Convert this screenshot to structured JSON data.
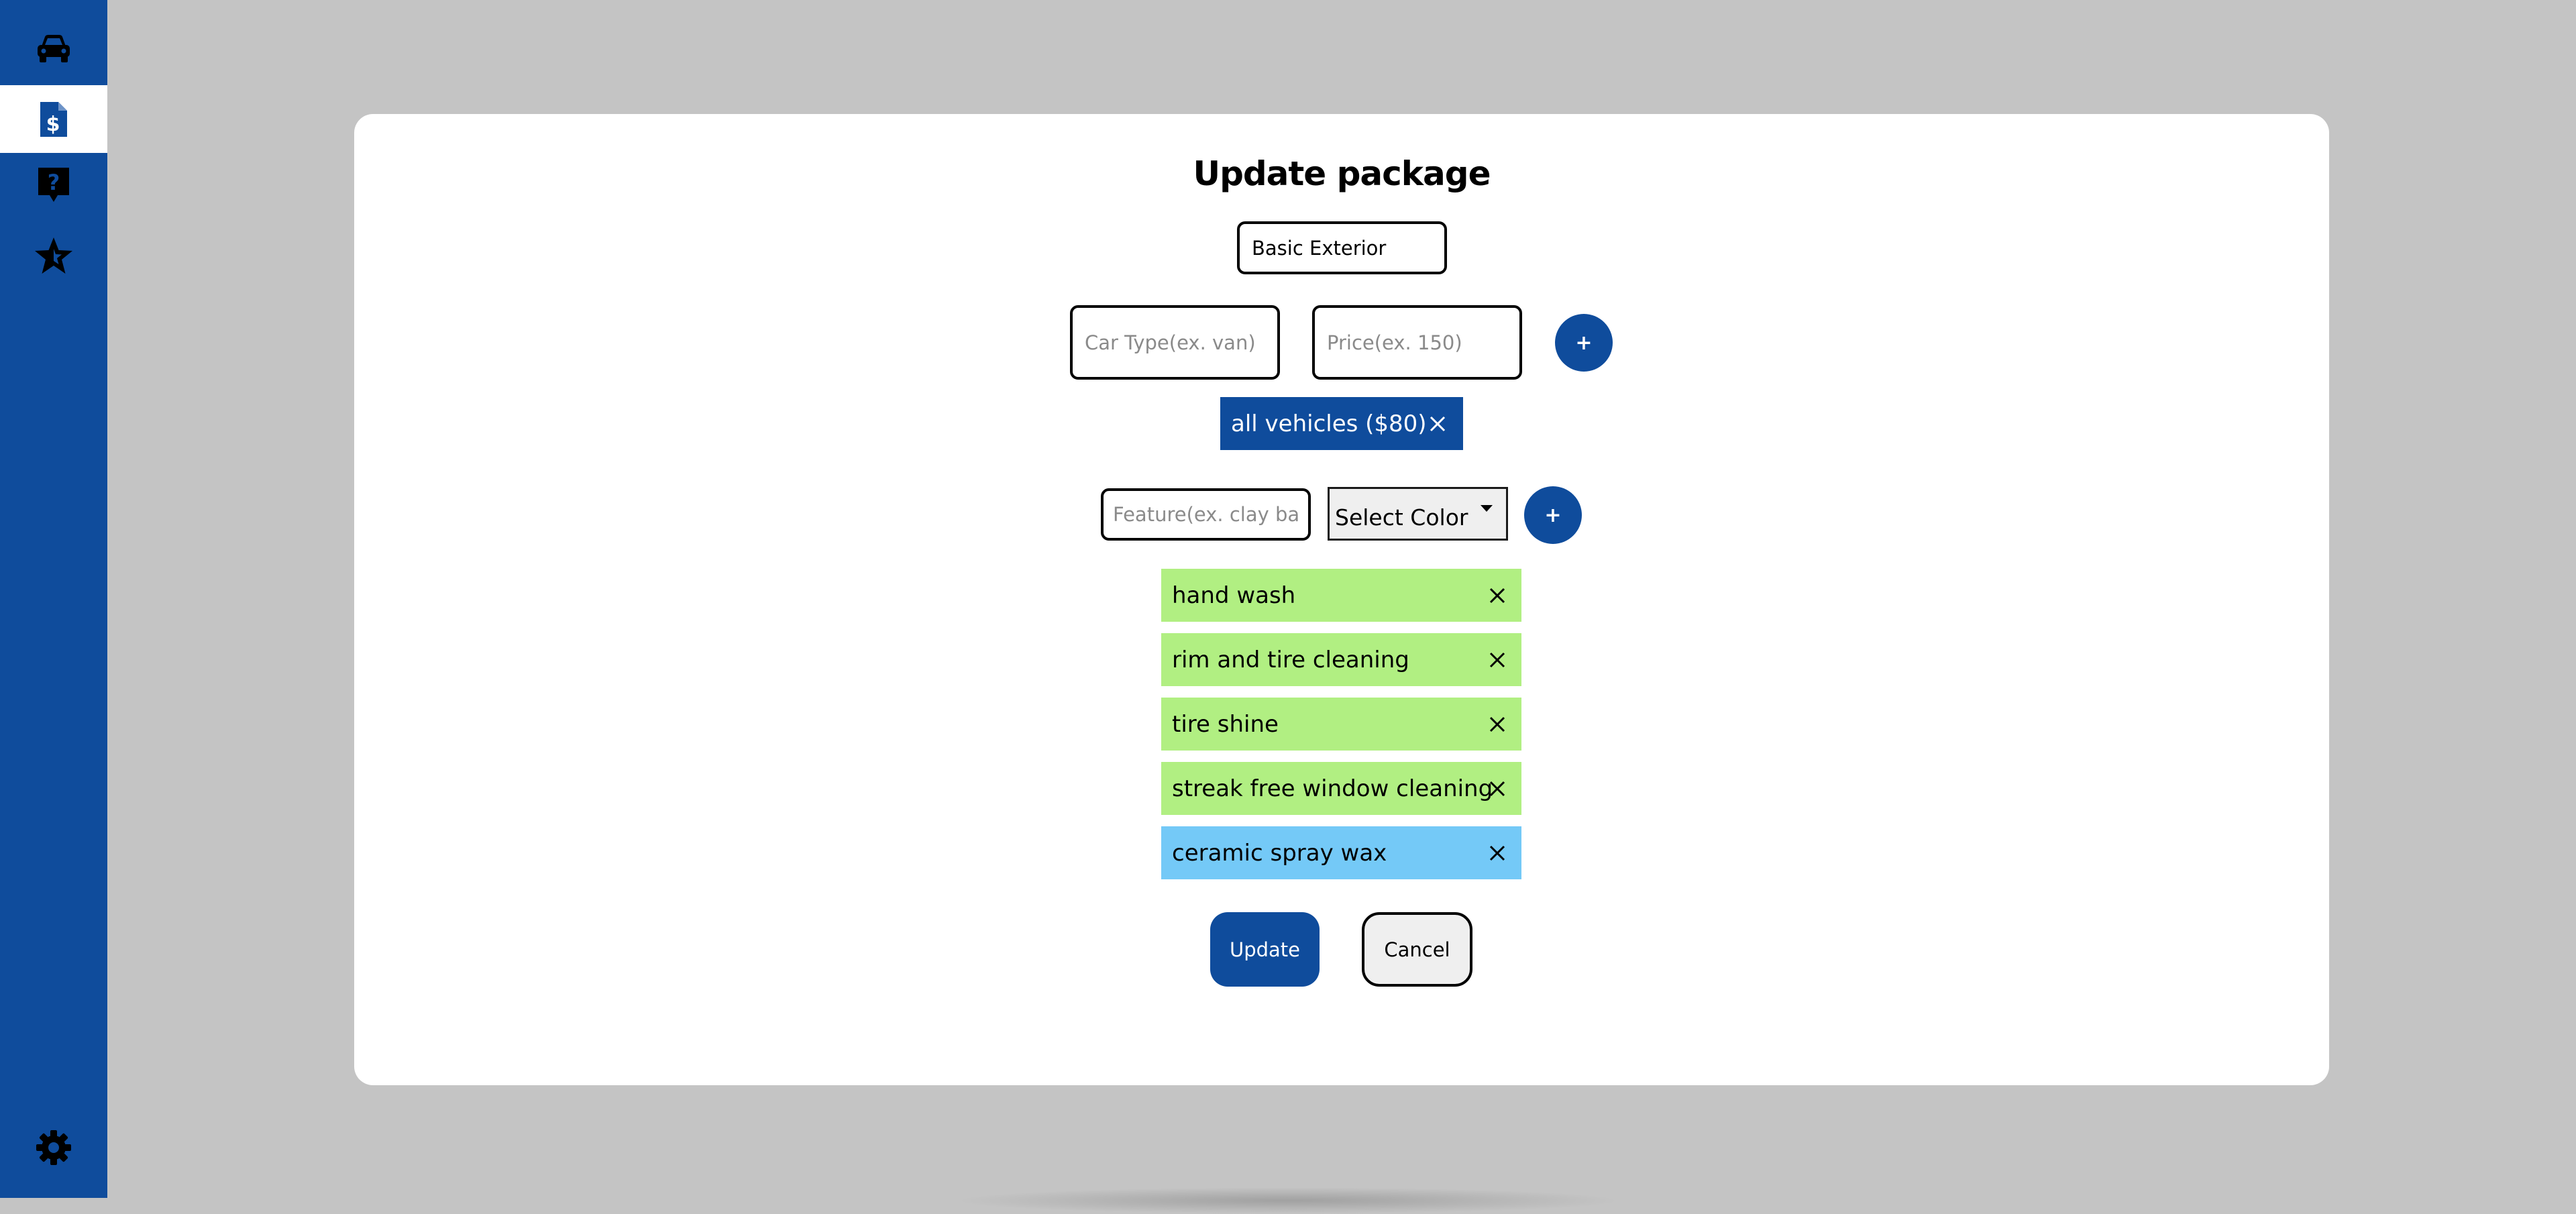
{
  "sidebar": {
    "items": [
      {
        "icon": "car-icon"
      },
      {
        "icon": "price-document-icon",
        "active": true
      },
      {
        "icon": "help-icon"
      },
      {
        "icon": "star-icon"
      }
    ],
    "bottom_icon": "gear-icon"
  },
  "modal": {
    "title": "Update package",
    "package_name": "Basic Exterior",
    "car_type_placeholder": "Car Type(ex. van)",
    "price_placeholder": "Price(ex. 150)",
    "add_price_label": "+",
    "vehicle_prices": [
      {
        "label": "all vehicles ($80)"
      }
    ],
    "feature_placeholder": "Feature(ex. clay bar)",
    "select_color_label": "Select Color",
    "add_feature_label": "+",
    "features": [
      {
        "label": "hand wash",
        "color": "#b1ef82"
      },
      {
        "label": "rim and tire cleaning",
        "color": "#b1ef82"
      },
      {
        "label": "tire shine",
        "color": "#b1ef82"
      },
      {
        "label": "streak free window cleaning",
        "color": "#b1ef82"
      },
      {
        "label": "ceramic spray wax",
        "color": "#74c9f7"
      }
    ],
    "update_label": "Update",
    "cancel_label": "Cancel"
  },
  "colors": {
    "primary": "#0f4c9c",
    "backdrop": "#c4c4c4"
  }
}
